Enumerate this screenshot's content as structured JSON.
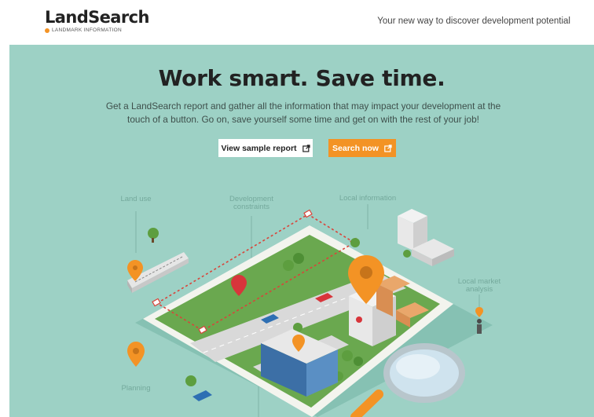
{
  "header": {
    "logo_text": "LandSearch",
    "logo_subtext": "LANDMARK INFORMATION",
    "tagline": "Your new way to discover development potential"
  },
  "hero": {
    "headline": "Work smart. Save time.",
    "subtext": "Get a LandSearch report and gather all the information that may impact your development at the touch of a button. Go on, save yourself some time and get on with the rest of your job!",
    "buttons": {
      "sample_label": "View sample report",
      "search_label": "Search now"
    }
  },
  "illustration": {
    "labels": {
      "land_use": "Land use",
      "dev_constraints_1": "Development",
      "dev_constraints_2": "constraints",
      "local_info": "Local information",
      "local_market_1": "Local market",
      "local_market_2": "analysis",
      "planning": "Planning"
    }
  },
  "colors": {
    "accent": "#f39325",
    "hero_bg": "#9dd1c5",
    "grass": "#6aa84f",
    "road": "#d9d9d9"
  },
  "icons": [
    "external-link-icon",
    "map-pin-icon",
    "magnifier-icon",
    "building-icon",
    "train-icon",
    "tree-icon",
    "car-icon"
  ]
}
